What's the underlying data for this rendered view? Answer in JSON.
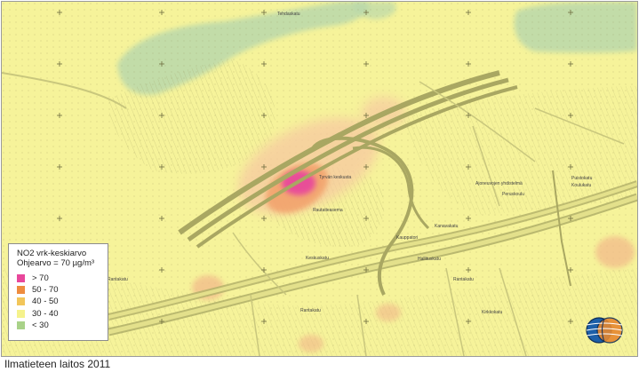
{
  "legend": {
    "title": "NO2 vrk-keskiarvo",
    "limit_text": "Ohjearvo = 70 µg/m³",
    "classes": [
      {
        "label": "> 70",
        "color": "#e8479b"
      },
      {
        "label": "50 - 70",
        "color": "#ee8c3e"
      },
      {
        "label": "40 - 50",
        "color": "#f2c65a"
      },
      {
        "label": "30 - 40",
        "color": "#f5f28c"
      },
      {
        "label": "< 30",
        "color": "#a9d289"
      }
    ]
  },
  "credit": "Ilmatieteen laitos 2011",
  "map_labels": {
    "l1": "Tyrvän keskusta",
    "l2": "Rautatieasema",
    "l3": "Kauppatori",
    "l4": "Kanavakatu",
    "l5": "Ajoneuvojen yhdistelmä",
    "l6": "Peruskoulu",
    "l7": "Keskuskatu",
    "l8": "Rantakatu",
    "l9": "Rantakatu",
    "l10": "Rantakatu",
    "l11": "Puistokatu",
    "l12": "Koulukatu",
    "l13": "Hallituskatu",
    "l14": "Kirkkokatu",
    "l15": "Tehdaskatu"
  },
  "colors": {
    "background": "#f6f39a",
    "water": "#b8d8a8",
    "hotspot": "#e8479b",
    "orange": "#f2a06a",
    "road": "#b5b46a",
    "street": "#c9c77d"
  }
}
